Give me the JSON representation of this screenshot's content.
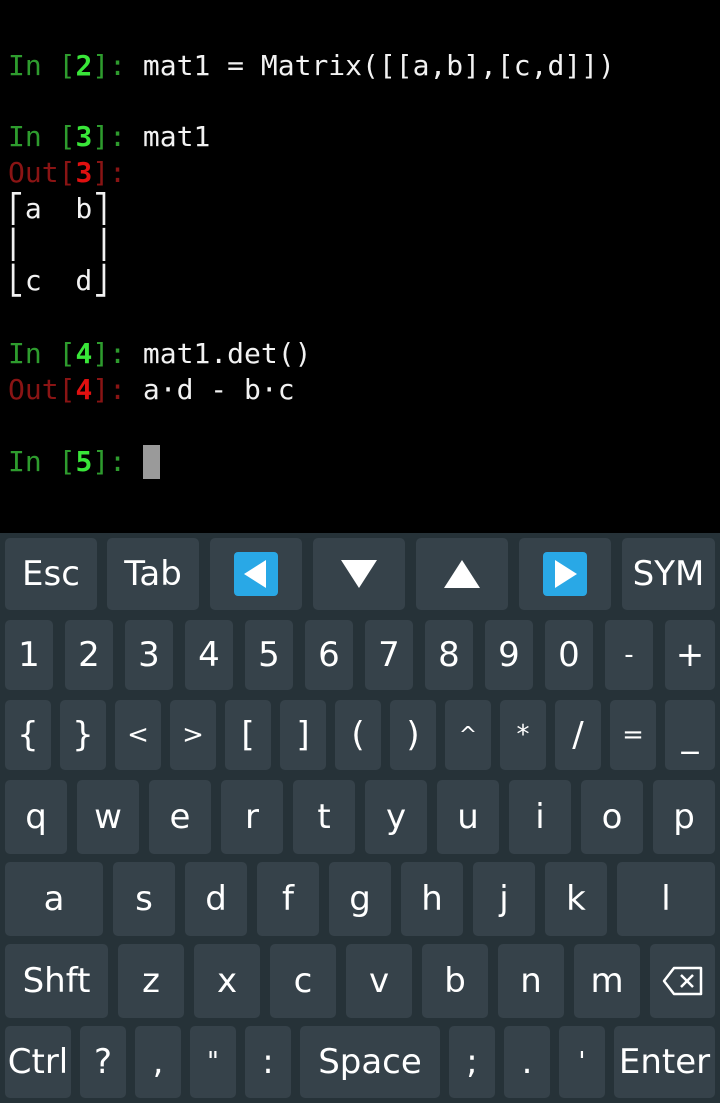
{
  "terminal": {
    "lines": [
      {
        "prompt_kind": "in",
        "pre": "In [",
        "num": "2",
        "post": "]: ",
        "code": "mat1 = Matrix([[a,b],[c,d]])"
      },
      {
        "prompt_kind": "in",
        "pre": "In [",
        "num": "3",
        "post": "]: ",
        "code": "mat1"
      },
      {
        "prompt_kind": "out",
        "pre": "Out[",
        "num": "3",
        "post": "]:",
        "code": ""
      },
      {
        "prompt_kind": "plain",
        "code": "⎡a  b⎤"
      },
      {
        "prompt_kind": "plain",
        "code": "⎢    ⎥"
      },
      {
        "prompt_kind": "plain",
        "code": "⎣c  d⎦"
      },
      {
        "prompt_kind": "in",
        "pre": "In [",
        "num": "4",
        "post": "]: ",
        "code": "mat1.det()"
      },
      {
        "prompt_kind": "out",
        "pre": "Out[",
        "num": "4",
        "post": "]: ",
        "code": "a⋅d - b⋅c"
      },
      {
        "prompt_kind": "in",
        "pre": "In [",
        "num": "5",
        "post": "]: ",
        "code": ""
      }
    ]
  },
  "keyboard": {
    "row1": [
      "Esc",
      "Tab",
      "◀",
      "▼",
      "▲",
      "▶",
      "SYM"
    ],
    "row2": [
      "1",
      "2",
      "3",
      "4",
      "5",
      "6",
      "7",
      "8",
      "9",
      "0",
      "-",
      "+"
    ],
    "row3": [
      "{",
      "}",
      "<",
      ">",
      "[",
      "]",
      "(",
      ")",
      "^",
      "*",
      "/",
      "=",
      "_"
    ],
    "row4": [
      "q",
      "w",
      "e",
      "r",
      "t",
      "y",
      "u",
      "i",
      "o",
      "p"
    ],
    "row5": [
      "a",
      "s",
      "d",
      "f",
      "g",
      "h",
      "j",
      "k",
      "l"
    ],
    "row6": [
      "Shft",
      "z",
      "x",
      "c",
      "v",
      "b",
      "n",
      "m",
      "⌫"
    ],
    "row7": [
      "Ctrl",
      "?",
      ",",
      "\"",
      ":",
      "Space",
      ";",
      ".",
      "'",
      "Enter"
    ],
    "icons": {
      "left": "left-arrow-icon",
      "down": "down-arrow-icon",
      "up": "up-arrow-icon",
      "right": "right-arrow-icon",
      "backspace": "backspace-icon"
    },
    "colors": {
      "background": "#263238",
      "key": "#36424a",
      "arrow_blue": "#29a8e6",
      "in_green": "#2e9c2e",
      "out_red": "#8a1414"
    }
  }
}
